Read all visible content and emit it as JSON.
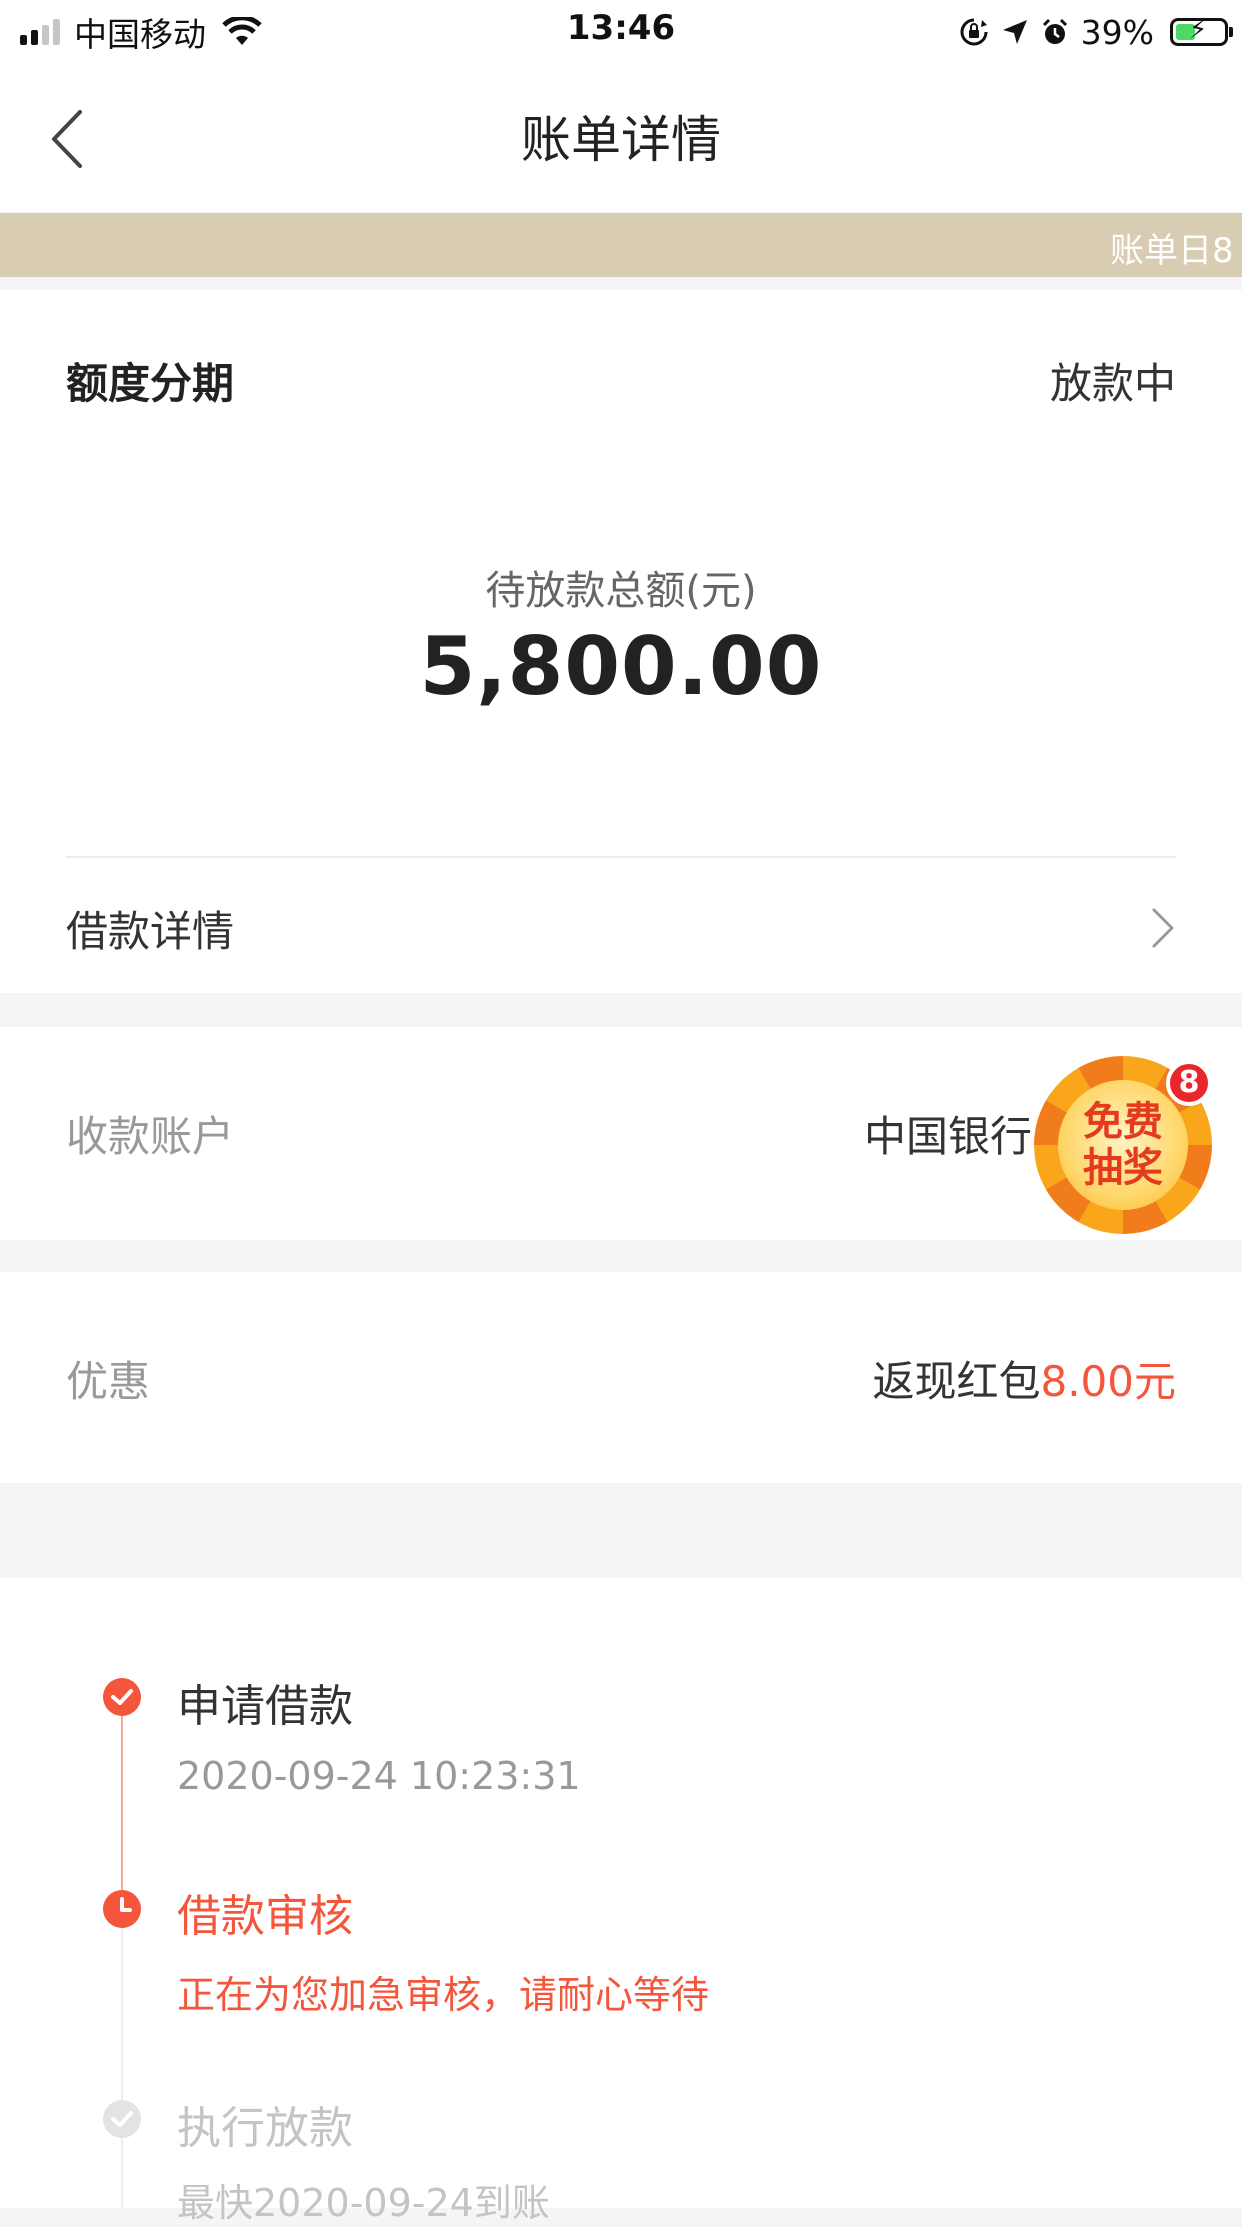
{
  "status_bar": {
    "carrier": "中国移动",
    "time": "13:46",
    "battery": "39%"
  },
  "nav": {
    "title": "账单详情"
  },
  "notice": {
    "text": "账单日8"
  },
  "summary": {
    "product": "额度分期",
    "status": "放款中",
    "amount_label": "待放款总额(元)",
    "amount": "5,800.00",
    "detail_link": "借款详情"
  },
  "account": {
    "label": "收款账户",
    "value": "中国银行"
  },
  "discount": {
    "label": "优惠",
    "value_prefix": "返现红包",
    "value_amount": "8.00元"
  },
  "lottery": {
    "line1": "免费",
    "line2": "抽奖",
    "count": "8"
  },
  "timeline": [
    {
      "title": "申请借款",
      "sub": "2020-09-24 10:23:31",
      "state": "done"
    },
    {
      "title": "借款审核",
      "sub": "正在为您加急审核，请耐心等待",
      "state": "active"
    },
    {
      "title": "执行放款",
      "sub": "最快2020-09-24到账",
      "state": "pending"
    }
  ],
  "colors": {
    "accent_red": "#f4553b",
    "notice_bg": "#d8ccb3",
    "pending_gray": "#cccccc"
  }
}
